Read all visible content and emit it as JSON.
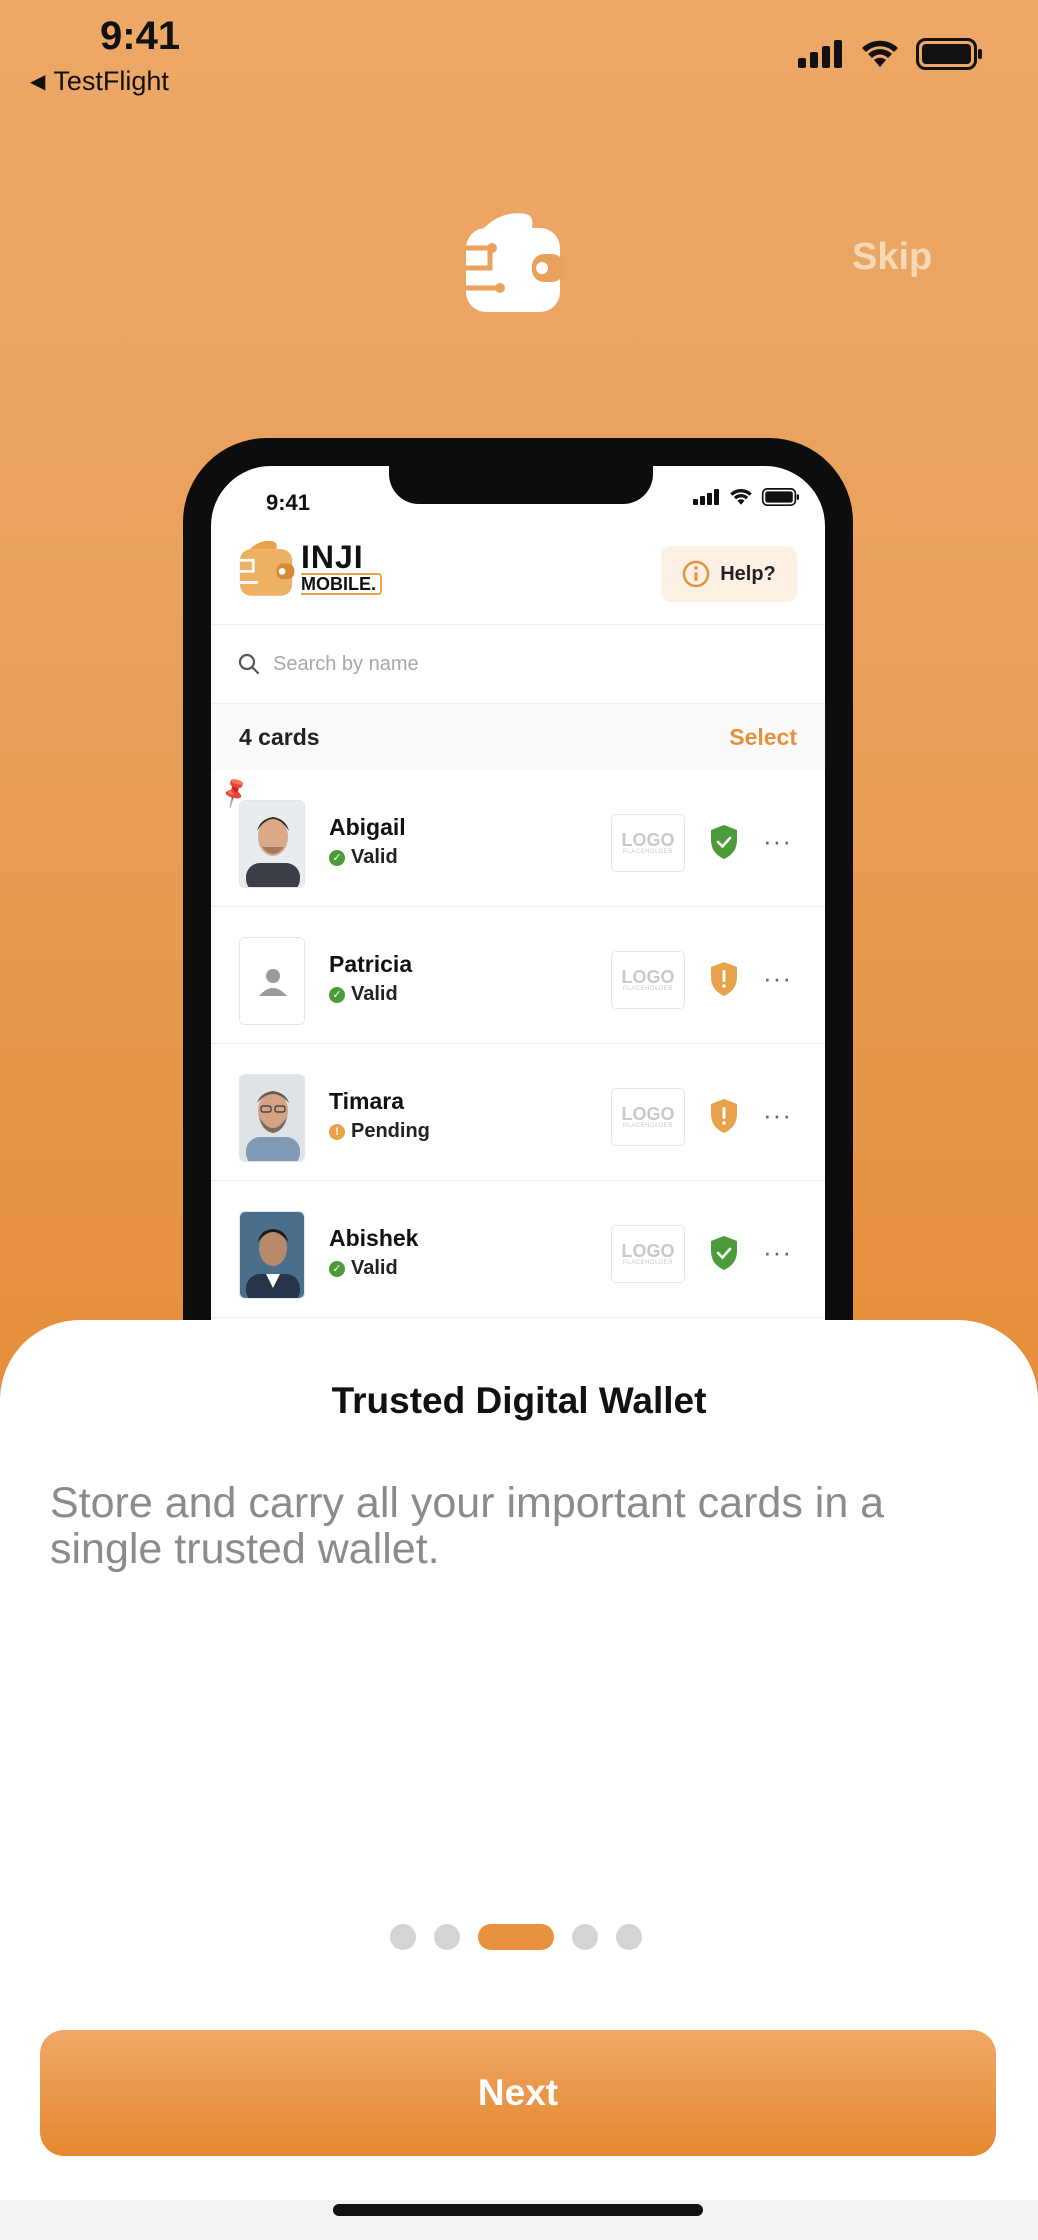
{
  "status_bar": {
    "time": "9:41",
    "back_label": "TestFlight"
  },
  "header": {
    "skip_label": "Skip",
    "logo_icon": "wallet-icon"
  },
  "mockup": {
    "time": "9:41",
    "brand_line1": "INJI",
    "brand_line2": "MOBILE.",
    "help_label": "Help?",
    "search_placeholder": "Search by name",
    "cards_count": "4 cards",
    "select_label": "Select",
    "logo_line1": "LOGO",
    "logo_line2": "PLACEHOLDER",
    "more_label": "···",
    "cards": [
      {
        "name": "Abigail",
        "status": "Valid",
        "status_type": "valid",
        "pinned": true,
        "shield": "green"
      },
      {
        "name": "Patricia",
        "status": "Valid",
        "status_type": "valid",
        "pinned": false,
        "shield": "orange"
      },
      {
        "name": "Timara",
        "status": "Pending",
        "status_type": "pending",
        "pinned": false,
        "shield": "orange"
      },
      {
        "name": "Abishek",
        "status": "Valid",
        "status_type": "valid",
        "pinned": false,
        "shield": "green"
      }
    ]
  },
  "sheet": {
    "title": "Trusted Digital Wallet",
    "description": "Store and carry all your important cards in a single trusted wallet.",
    "pages_total": 5,
    "active_page": 3,
    "next_label": "Next"
  },
  "colors": {
    "accent": "#e8913c",
    "valid_green": "#4c9a3a",
    "pending_orange": "#e8a24a"
  }
}
